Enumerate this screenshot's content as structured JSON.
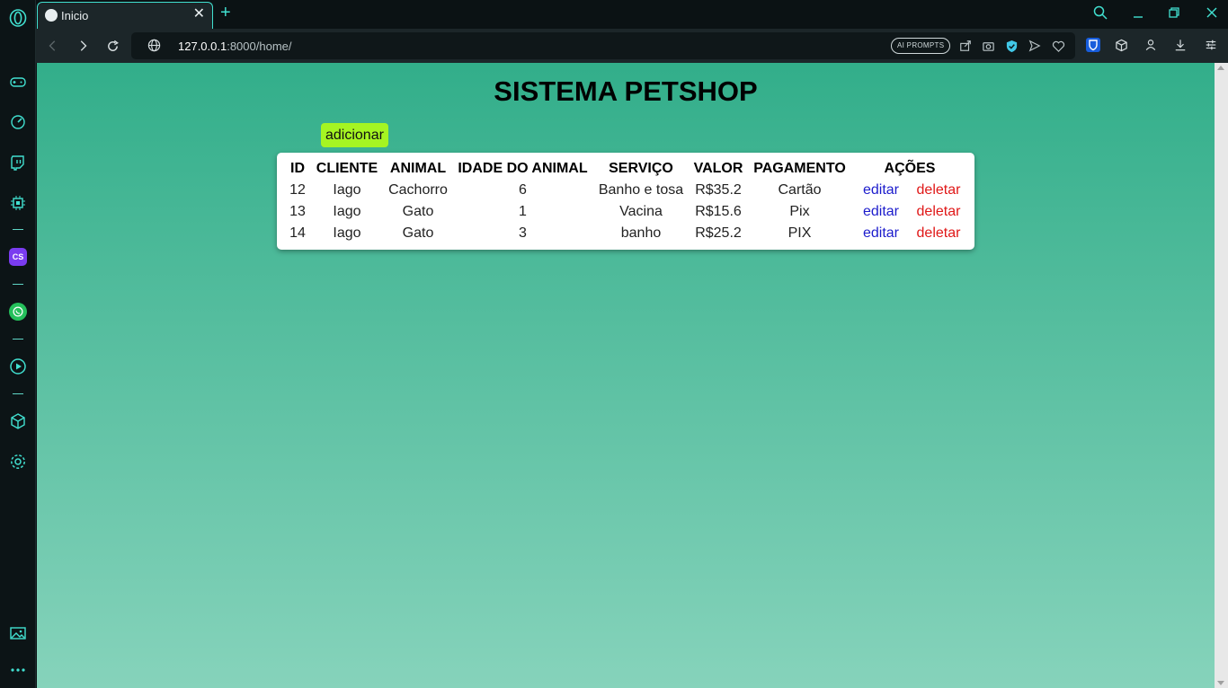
{
  "browser": {
    "tab_title": "Inicio",
    "url_host": "127.0.0.1",
    "url_rest": ":8000/home/",
    "ai_prompts_label": "AI PROMPTS",
    "cs_badge": "CS"
  },
  "page": {
    "title": "SISTEMA PETSHOP",
    "add_button": "adicionar",
    "table": {
      "headers": [
        "ID",
        "CLIENTE",
        "ANIMAL",
        "IDADE DO ANIMAL",
        "SERVIÇO",
        "VALOR",
        "PAGAMENTO",
        "AÇÕES"
      ],
      "rows": [
        {
          "id": "12",
          "cliente": "Iago",
          "animal": "Cachorro",
          "idade": "6",
          "servico": "Banho e tosa",
          "valor": "R$35.2",
          "pagamento": "Cartão",
          "editar": "editar",
          "deletar": "deletar"
        },
        {
          "id": "13",
          "cliente": "Iago",
          "animal": "Gato",
          "idade": "1",
          "servico": "Vacina",
          "valor": "R$15.6",
          "pagamento": "Pix",
          "editar": "editar",
          "deletar": "deletar"
        },
        {
          "id": "14",
          "cliente": "Iago",
          "animal": "Gato",
          "idade": "3",
          "servico": "banho",
          "valor": "R$25.2",
          "pagamento": "PIX",
          "editar": "editar",
          "deletar": "deletar"
        }
      ]
    }
  },
  "colors": {
    "accent": "#41e0d0",
    "add_button_bg": "#a5f522",
    "edit_link": "#1c1ccc",
    "delete_link": "#e01818",
    "bg_top": "#32ae8a",
    "bg_bottom": "#86d3bb"
  },
  "icons": {
    "sidebar": [
      "opera-logo-icon",
      "gamepad-icon",
      "speedometer-icon",
      "twitch-icon",
      "cpu-icon",
      "cs-app-icon",
      "whatsapp-icon",
      "player-icon",
      "cube-icon",
      "settings-icon",
      "gallery-icon",
      "more-icon"
    ],
    "toolbar": [
      "search-icon",
      "minimize-icon",
      "restore-icon",
      "close-icon",
      "back-icon",
      "forward-icon",
      "reload-icon",
      "globe-icon",
      "share-icon",
      "camera-icon",
      "vpn-shield-icon",
      "send-icon",
      "heart-icon",
      "bitwarden-icon",
      "extension-cube-icon",
      "profile-icon",
      "download-icon",
      "easy-setup-icon"
    ]
  }
}
